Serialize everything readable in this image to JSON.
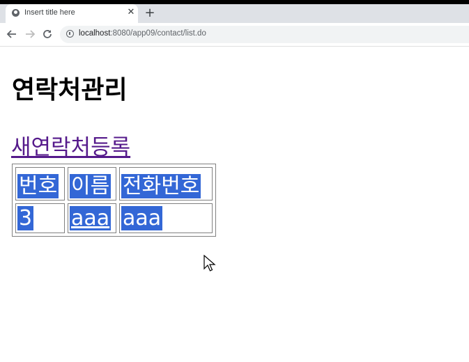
{
  "browser": {
    "tab_title": "Insert title here",
    "tab_close_glyph": "✕",
    "new_tab_glyph": "+",
    "url_host": "localhost",
    "url_rest": ":8080/app09/contact/list.do",
    "icons": {
      "back": "arrow-left-icon",
      "forward": "arrow-right-icon",
      "reload": "reload-icon",
      "site_info": "info-icon",
      "favicon": "globe-icon"
    }
  },
  "page": {
    "title": "연락처관리",
    "new_contact_link": "새연락처등록",
    "table": {
      "headers": [
        "번호",
        "이름",
        "전화번호"
      ],
      "rows": [
        [
          "3",
          "aaa",
          "aaa"
        ]
      ]
    },
    "colors": {
      "selection": "#3367d6",
      "visited_link": "#551a8b"
    }
  }
}
